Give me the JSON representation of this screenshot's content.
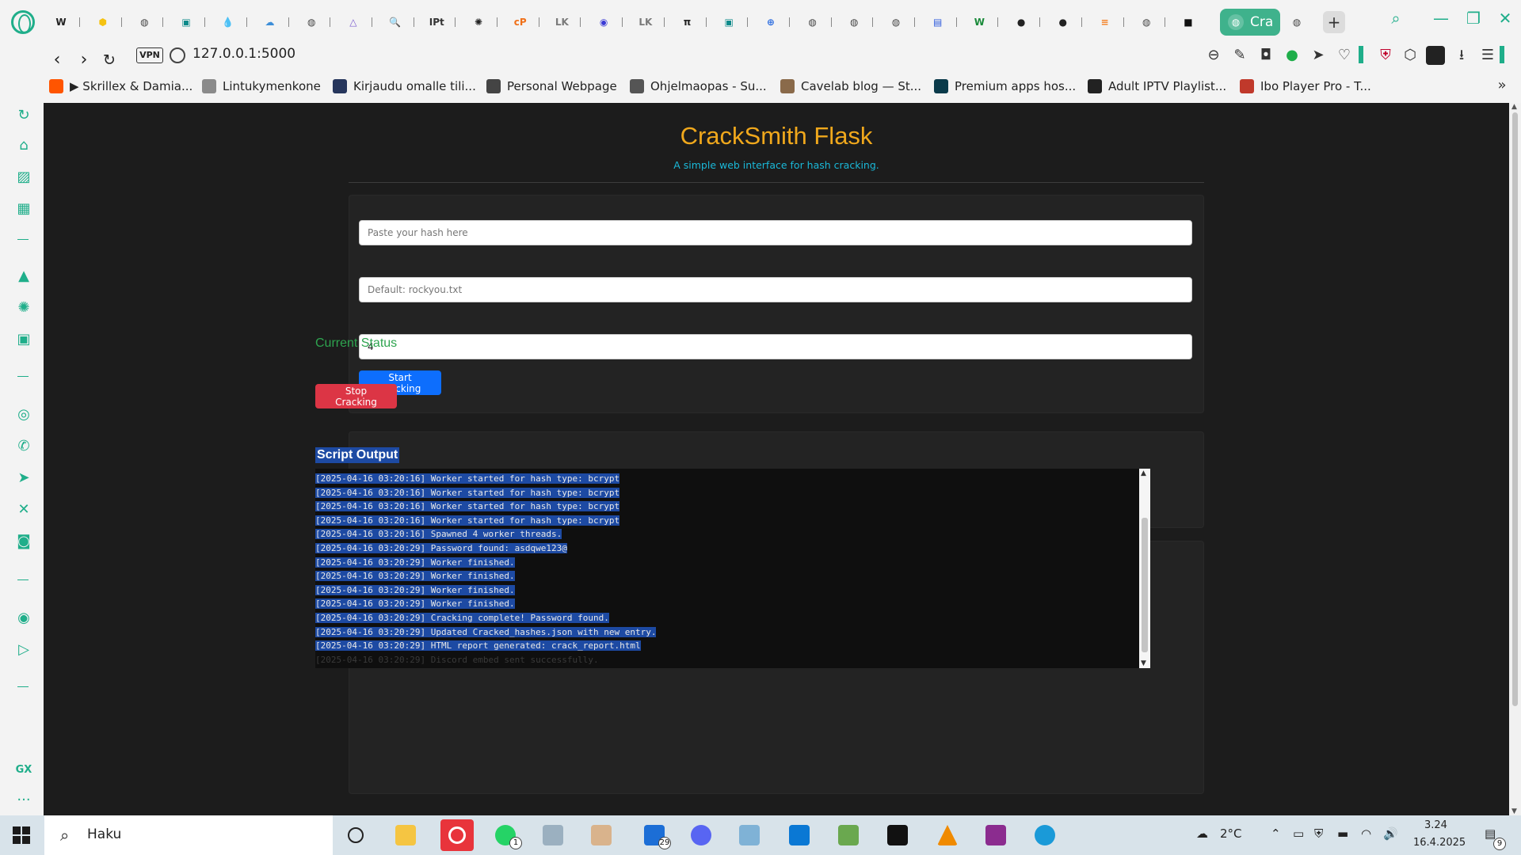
{
  "browser": {
    "address": "127.0.0.1:5000",
    "vpn_label": "VPN",
    "active_tab_title": "Cra",
    "tabs": [
      {
        "icon": "w-icon",
        "glyph": "W",
        "color": "#222222"
      },
      {
        "icon": "hexagon-icon",
        "glyph": "⬢",
        "color": "#f5c211"
      },
      {
        "icon": "globe-icon",
        "glyph": "◍",
        "color": "#444444"
      },
      {
        "icon": "app-icon",
        "glyph": "▣",
        "color": "#0d8a8a"
      },
      {
        "icon": "drop-icon",
        "glyph": "💧",
        "color": "#1e6ad8"
      },
      {
        "icon": "cloud-icon",
        "glyph": "☁",
        "color": "#3d8ed8"
      },
      {
        "icon": "globe-icon",
        "glyph": "◍",
        "color": "#444444"
      },
      {
        "icon": "triangle-icon",
        "glyph": "△",
        "color": "#7b5ccf"
      },
      {
        "icon": "search-doc-icon",
        "glyph": "🔍",
        "color": "#666666"
      },
      {
        "icon": "ipt-icon",
        "glyph": "IPt",
        "color": "#333333"
      },
      {
        "icon": "openai-icon",
        "glyph": "✺",
        "color": "#222222"
      },
      {
        "icon": "cp-icon",
        "glyph": "cP",
        "color": "#f07019"
      },
      {
        "icon": "lk-icon",
        "glyph": "LK",
        "color": "#7a7a7a"
      },
      {
        "icon": "circle-icon",
        "glyph": "◉",
        "color": "#3b3bd6"
      },
      {
        "icon": "lk-icon",
        "glyph": "LK",
        "color": "#7a7a7a"
      },
      {
        "icon": "pi-icon",
        "glyph": "π",
        "color": "#222222"
      },
      {
        "icon": "app-icon",
        "glyph": "▣",
        "color": "#0d8a8a"
      },
      {
        "icon": "plus-circle-icon",
        "glyph": "⊕",
        "color": "#2f6fe0"
      },
      {
        "icon": "globe-icon",
        "glyph": "◍",
        "color": "#444444"
      },
      {
        "icon": "globe-icon",
        "glyph": "◍",
        "color": "#444444"
      },
      {
        "icon": "globe-icon",
        "glyph": "◍",
        "color": "#444444"
      },
      {
        "icon": "forms-icon",
        "glyph": "▤",
        "color": "#2e5bdc"
      },
      {
        "icon": "w-green-icon",
        "glyph": "W",
        "color": "#1a8a3a"
      },
      {
        "icon": "github-icon",
        "glyph": "●",
        "color": "#222222"
      },
      {
        "icon": "github-icon",
        "glyph": "●",
        "color": "#222222"
      },
      {
        "icon": "stack-icon",
        "glyph": "≡",
        "color": "#f48024"
      },
      {
        "icon": "globe-icon",
        "glyph": "◍",
        "color": "#444444"
      },
      {
        "icon": "black-square-icon",
        "glyph": "■",
        "color": "#111111"
      }
    ],
    "bookmarks": [
      {
        "label": "▶ Skrillex & Damia...",
        "icon_color": "#ff5500"
      },
      {
        "label": "Lintukymenkone",
        "icon_color": "#8a8a8a"
      },
      {
        "label": "Kirjaudu omalle tili...",
        "icon_color": "#26365c"
      },
      {
        "label": "Personal Webpage",
        "icon_color": "#444444"
      },
      {
        "label": "Ohjelmaopas - Su...",
        "icon_color": "#555555"
      },
      {
        "label": "Cavelab blog — St...",
        "icon_color": "#8a6a4a"
      },
      {
        "label": "Premium apps hos...",
        "icon_color": "#0a3a4a"
      },
      {
        "label": "Adult IPTV Playlist...",
        "icon_color": "#222222"
      },
      {
        "label": "Ibo Player Pro - T...",
        "icon_color": "#c0392b"
      }
    ]
  },
  "app": {
    "title": "CrackSmith Flask",
    "subtitle": "A simple web interface for hash cracking.",
    "hash_placeholder": "Paste your hash here",
    "wordlist_placeholder": "Default: rockyou.txt",
    "threads_value": "4",
    "start_label": "Start Cracking",
    "status_heading": "Current Status",
    "stop_label": "Stop Cracking",
    "output_heading": "Script Output",
    "log_lines": [
      "[2025-04-16 03:20:16] Worker started for hash type: bcrypt",
      "[2025-04-16 03:20:16] Worker started for hash type: bcrypt",
      "[2025-04-16 03:20:16] Worker started for hash type: bcrypt",
      "[2025-04-16 03:20:16] Worker started for hash type: bcrypt",
      "[2025-04-16 03:20:16] Spawned 4 worker threads.",
      "[2025-04-16 03:20:29] Password found: asdqwe123@",
      "[2025-04-16 03:20:29] Worker finished.",
      "[2025-04-16 03:20:29] Worker finished.",
      "[2025-04-16 03:20:29] Worker finished.",
      "[2025-04-16 03:20:29] Worker finished.",
      "[2025-04-16 03:20:29] Cracking complete! Password found.",
      "[2025-04-16 03:20:29] Updated Cracked_hashes.json with new entry.",
      "[2025-04-16 03:20:29] HTML report generated: crack_report.html",
      "[2025-04-16 03:20:29] Discord embed sent successfully."
    ],
    "colors": {
      "title": "#f0a81c",
      "subtitle": "#1ab8d8",
      "start": "#0d6efd",
      "stop": "#dc3545",
      "status": "#2ea44f"
    }
  },
  "taskbar": {
    "search_text": "Haku",
    "whatsapp_badge": "1",
    "outlook_badge": "29",
    "temperature": "2°C",
    "time": "3.24",
    "date": "16.4.2025",
    "notification_count": "9"
  }
}
